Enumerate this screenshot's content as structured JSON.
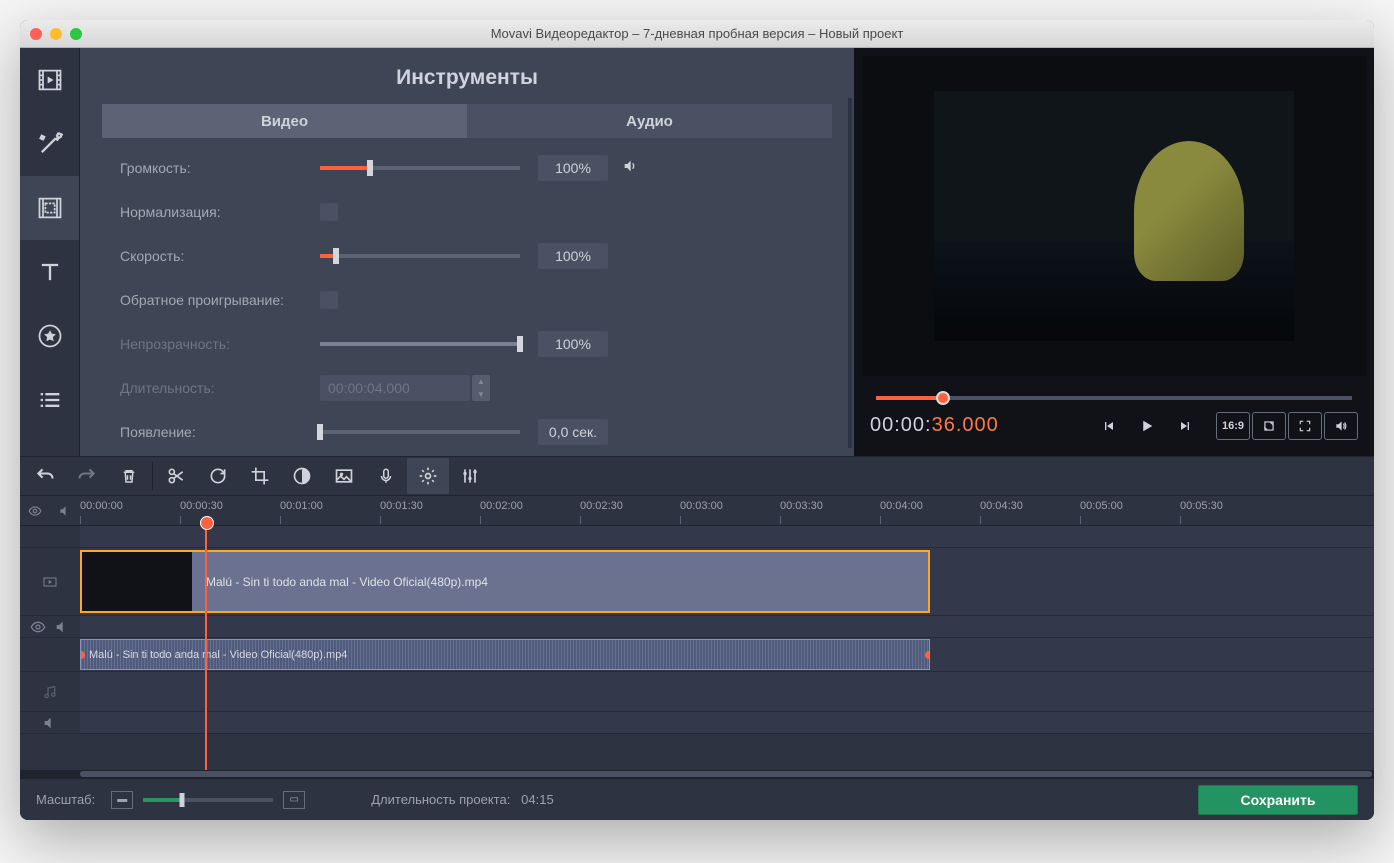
{
  "titlebar": {
    "title": "Movavi Видеоредактор – 7-дневная пробная версия – Новый проект"
  },
  "tools": {
    "header": "Инструменты",
    "tab_video": "Видео",
    "tab_audio": "Аудио",
    "volume_label": "Громкость:",
    "volume_value": "100%",
    "normalize_label": "Нормализация:",
    "speed_label": "Скорость:",
    "speed_value": "100%",
    "reverse_label": "Обратное проигрывание:",
    "opacity_label": "Непрозрачность:",
    "opacity_value": "100%",
    "duration_label": "Длительность:",
    "duration_value": "00:00:04.000",
    "fadein_label": "Появление:",
    "fadein_value": "0,0 сек."
  },
  "preview": {
    "timecode_gray": "00:00:",
    "timecode_orange": "36.000",
    "aspect": "16:9"
  },
  "ruler": [
    "00:00:00",
    "00:00:30",
    "00:01:00",
    "00:01:30",
    "00:02:00",
    "00:02:30",
    "00:03:00",
    "00:03:30",
    "00:04:00",
    "00:04:30",
    "00:05:00",
    "00:05:30"
  ],
  "clips": {
    "video": "Malú - Sin ti todo anda mal - Video Oficial(480p).mp4",
    "audio": "Malú - Sin ti todo anda mal - Video Oficial(480p).mp4"
  },
  "status": {
    "zoom_label": "Масштаб:",
    "duration_label": "Длительность проекта:",
    "duration_value": "04:15",
    "save": "Сохранить"
  }
}
